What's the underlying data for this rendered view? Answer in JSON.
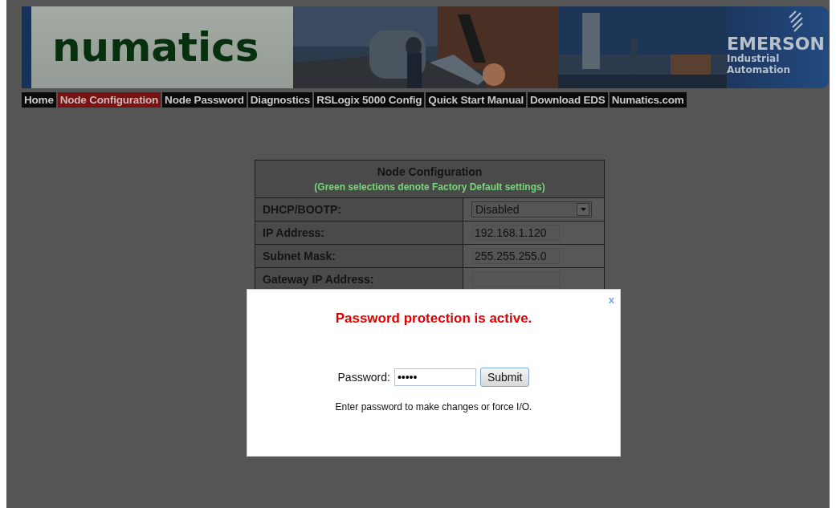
{
  "banner": {
    "logo": "numatics",
    "brand": "EMERSON",
    "tagline": "Industrial Automation"
  },
  "nav": [
    {
      "label": "Home",
      "selected": false
    },
    {
      "label": "Node Configuration",
      "selected": true
    },
    {
      "label": "Node Password",
      "selected": false
    },
    {
      "label": "Diagnostics",
      "selected": false
    },
    {
      "label": "RSLogix 5000 Config",
      "selected": false
    },
    {
      "label": "Quick Start Manual",
      "selected": false
    },
    {
      "label": "Download EDS",
      "selected": false
    },
    {
      "label": "Numatics.com",
      "selected": false
    }
  ],
  "config": {
    "title": "Node Configuration",
    "note": "(Green selections denote Factory Default settings)",
    "rows": [
      {
        "kind": "select",
        "label": "DHCP/BOOTP:",
        "value": "Disabled"
      },
      {
        "kind": "input",
        "label": "IP Address:",
        "value": "192.168.1.120"
      },
      {
        "kind": "input",
        "label": "Subnet Mask:",
        "value": "255.255.255.0"
      },
      {
        "kind": "input",
        "label": "Gateway IP Address:"
      }
    ]
  },
  "dialog": {
    "close": "x",
    "title": "Password protection is active.",
    "field_label": "Password:",
    "password": "•••••",
    "button": "Submit",
    "hint": "Enter password to make changes or force I/O."
  }
}
